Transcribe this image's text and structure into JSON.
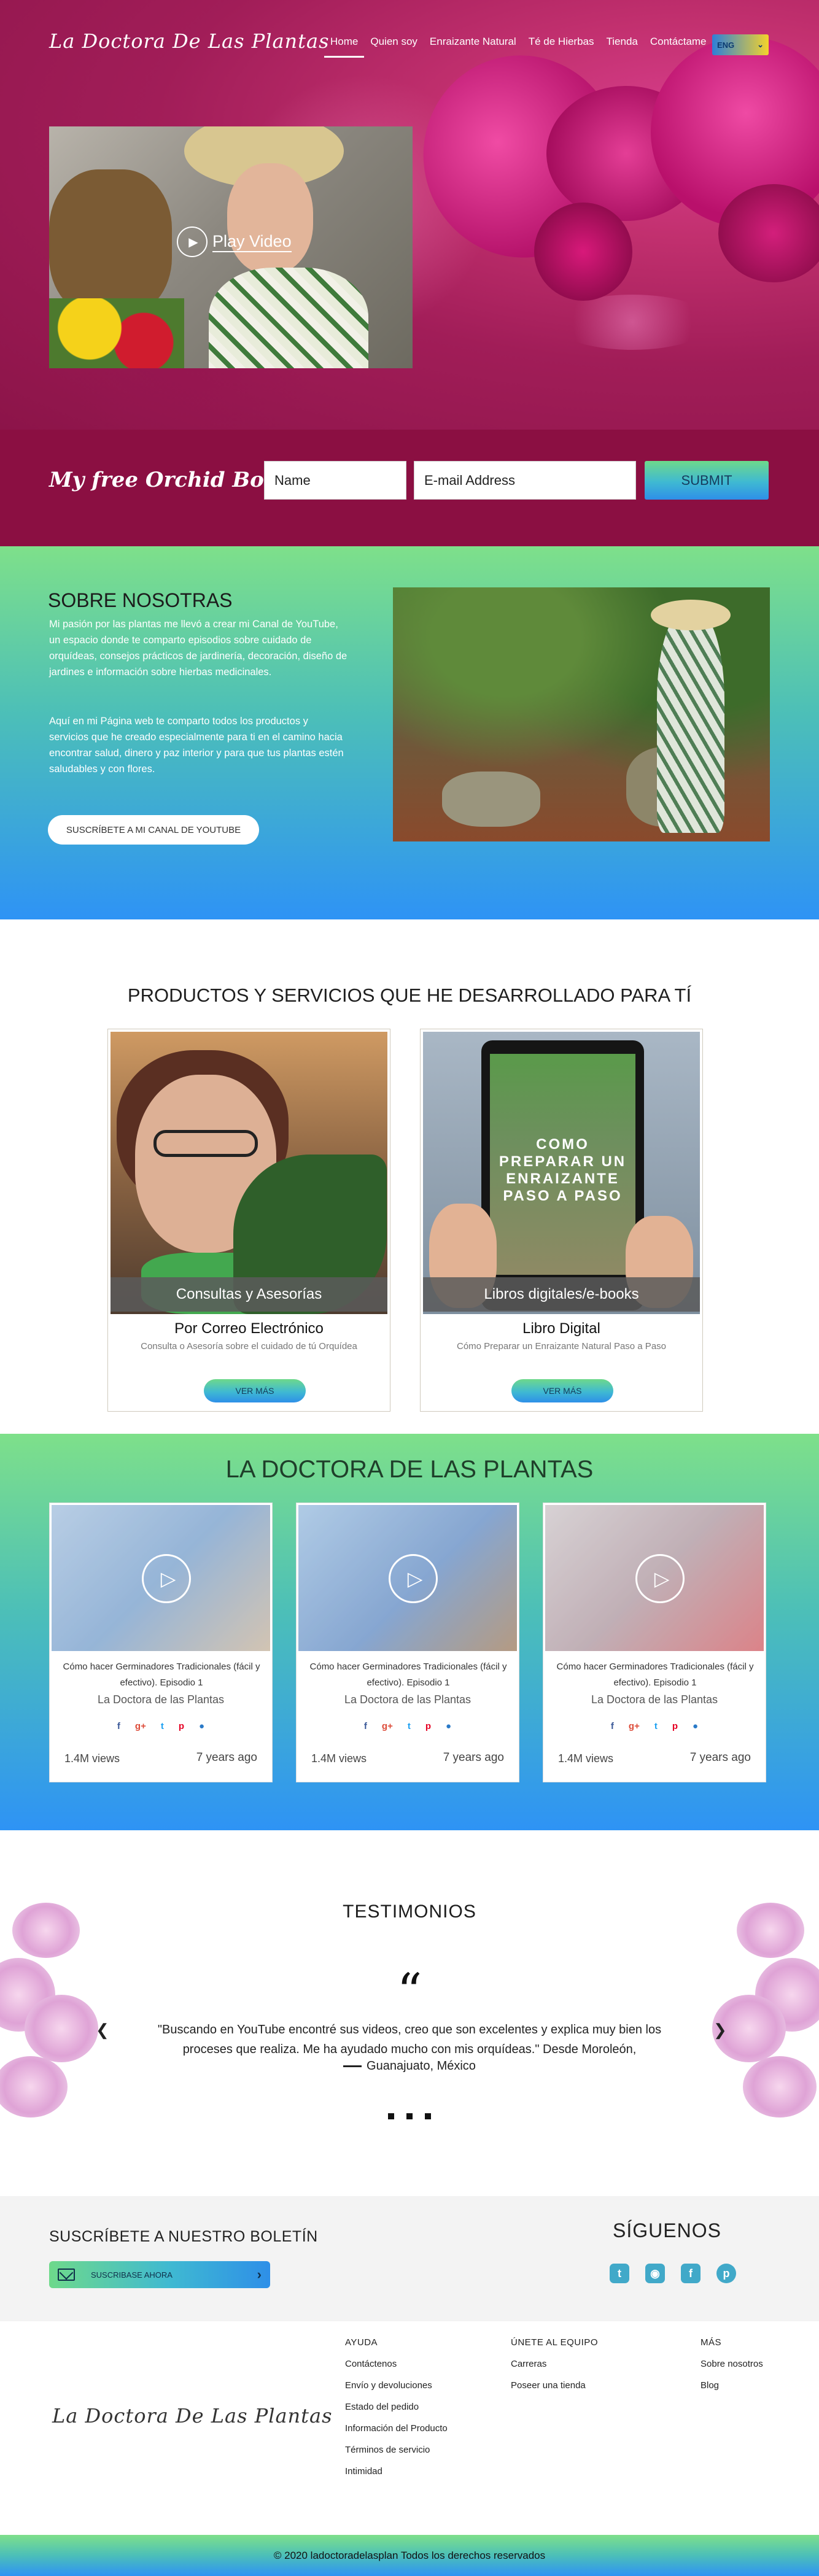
{
  "brand": {
    "logo_text": "La Doctora De Las Plantas"
  },
  "nav": {
    "items": [
      {
        "label": "Home"
      },
      {
        "label": "Quien soy"
      },
      {
        "label": "Enraizante Natural"
      },
      {
        "label": "Té de Hierbas"
      },
      {
        "label": "Tienda"
      },
      {
        "label": "Contáctame"
      }
    ],
    "active": "Home",
    "language": "ENG"
  },
  "hero": {
    "video_button_label": "Play Video"
  },
  "signup": {
    "title": "My free Orchid Book now",
    "name_placeholder": "Name",
    "email_placeholder": "E-mail Address",
    "submit_label": "SUBMIT"
  },
  "about": {
    "title": "SOBRE NOSOTRAS",
    "paragraph_1": "Mi pasión por las plantas me llevó a crear mi Canal de YouTube, un espacio donde te comparto episodios sobre cuidado de orquídeas,  consejos prácticos de jardinería, decoración, diseño de jardines e información sobre hierbas medicinales.",
    "paragraph_2": "Aquí en mi Página web te comparto todos los productos y servicios que he creado especialmente para ti en el camino hacia encontrar salud, dinero y paz interior y para que tus plantas estén saludables y con flores.",
    "button_label": "SUSCRÍBETE A MI CANAL DE YOUTUBE"
  },
  "products": {
    "title": "PRODUCTOS Y SERVICIOS QUE HE DESARROLLADO PARA TÍ",
    "cards": [
      {
        "caption": "Consultas y Asesorías",
        "subtitle": "Por  Correo Electrónico",
        "description": "Consulta o Asesoría sobre el cuidado de tú Orquídea",
        "button_label": "VER MÁS"
      },
      {
        "caption": "Libros digitales/e-books",
        "subtitle": "Libro Digital",
        "description": "Cómo Preparar un Enraizante Natural Paso a Paso",
        "button_label": "VER MÁS",
        "book_cover_title": "COMO PREPARAR UN ENRAIZANTE PASO A PASO"
      }
    ]
  },
  "videos": {
    "title": "LA DOCTORA DE LAS PLANTAS",
    "items": [
      {
        "title": "Cómo hacer Germinadores Tradicionales (fácil y efectivo). Episodio 1",
        "channel": "La Doctora de las Plantas",
        "views": "1.4M views",
        "age": "7 years ago"
      },
      {
        "title": "Cómo hacer Germinadores Tradicionales (fácil y efectivo). Episodio 1",
        "channel": "La Doctora de las Plantas",
        "views": "1.4M views",
        "age": "7 years ago"
      },
      {
        "title": "Cómo hacer Germinadores Tradicionales (fácil y efectivo). Episodio 1",
        "channel": "La Doctora de las Plantas",
        "views": "1.4M views",
        "age": "7 years ago"
      }
    ],
    "share_icons": [
      "facebook-icon",
      "google-plus-icon",
      "twitter-icon",
      "pinterest-icon",
      "tumblr-icon"
    ]
  },
  "testimonials": {
    "title": "TESTIMONIOS",
    "quote_mark": "“",
    "quote": "\"Buscando en YouTube encontré sus videos, creo que son excelentes y explica muy bien los proceses que realiza. Me ha ayudado mucho con mis orquídeas.\" Desde Moroleón,",
    "author": "Guanajuato, México"
  },
  "newsletter": {
    "title": "SUSCRÍBETE A NUESTRO BOLETÍN",
    "button_label": "SUSCRIBASE AHORA"
  },
  "follow": {
    "title": "SÍGUENOS",
    "icons": [
      "twitter-icon",
      "instagram-icon",
      "facebook-icon",
      "pinterest-icon"
    ]
  },
  "footer": {
    "col_1": {
      "title": "AYUDA",
      "links": [
        "Contáctenos",
        "Envío y devoluciones",
        "Estado del pedido",
        "Información del Producto",
        "Términos de servicio",
        "Intimidad"
      ]
    },
    "col_2": {
      "title": "ÚNETE AL EQUIPO",
      "links": [
        "Carreras",
        "Poseer una tienda"
      ]
    },
    "col_3": {
      "title": "MÁS",
      "links": [
        "Sobre nosotros",
        "Blog"
      ]
    },
    "copyright": "© 2020 ladoctoradelasplan Todos los derechos reservados"
  },
  "colors": {
    "hero_magenta": "#a11d58",
    "signup_bar": "#8b0f42",
    "gradient_green": "#7ee08a",
    "gradient_blue": "#2e93f5"
  }
}
